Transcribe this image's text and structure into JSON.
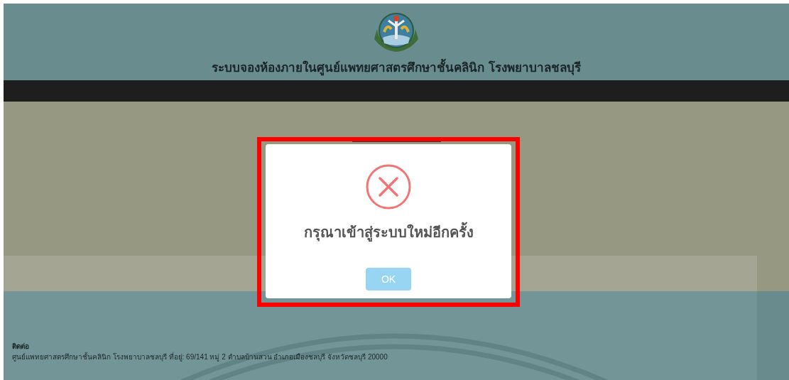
{
  "header": {
    "title": "ระบบจองห้องภายในศูนย์แพทยศาสตรศึกษาชั้นคลินิก โรงพยาบาลชลบุรี"
  },
  "dialog": {
    "kind": "error",
    "message": "กรุณาเข้าสู่ระบบใหม่อีกครั้ง",
    "button": "OK"
  },
  "footer": {
    "heading": "ติดต่อ",
    "address": "ศูนย์แพทยศาสตรศึกษาชั้นคลินิก โรงพยาบาลชลบุรี ที่อยู่: 69/141 หมู่ 2 ตำบลบ้านสวน อำเภอเมืองชลบุรี จังหวัดชลบุรี 20000"
  }
}
